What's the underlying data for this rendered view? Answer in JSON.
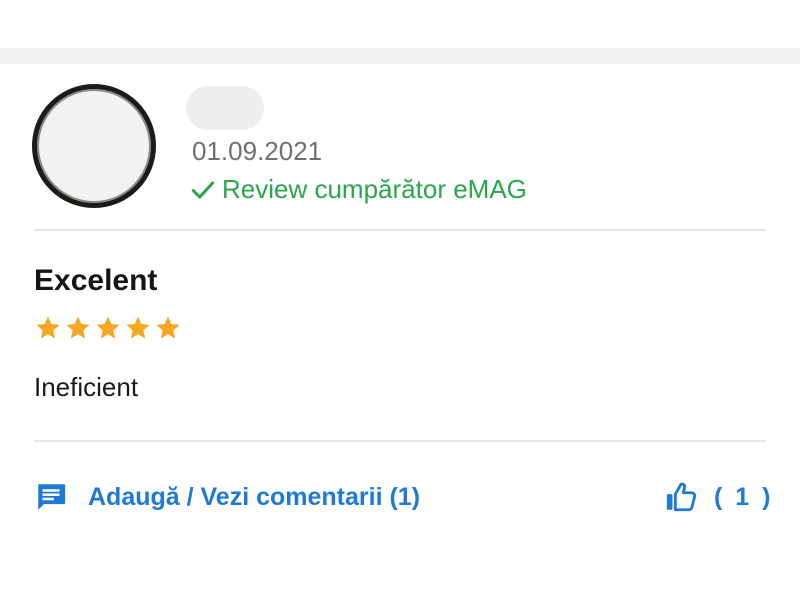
{
  "review": {
    "date": "01.09.2021",
    "verified_label": "Review cumpărător eMAG",
    "title": "Excelent",
    "rating": 5,
    "rating_max": 5,
    "body": "Ineficient",
    "comments_label": "Adaugă / Vezi comentarii (1)",
    "likes_label": "( 1 )"
  },
  "icons": {
    "verified": "check-icon",
    "star": "star-icon",
    "comments": "comment-icon",
    "like": "thumbs-up-icon"
  },
  "colors": {
    "accent_blue": "#1e7ad6",
    "verified_green": "#2aa64a",
    "star": "#f5a623",
    "date_gray": "#707070"
  }
}
